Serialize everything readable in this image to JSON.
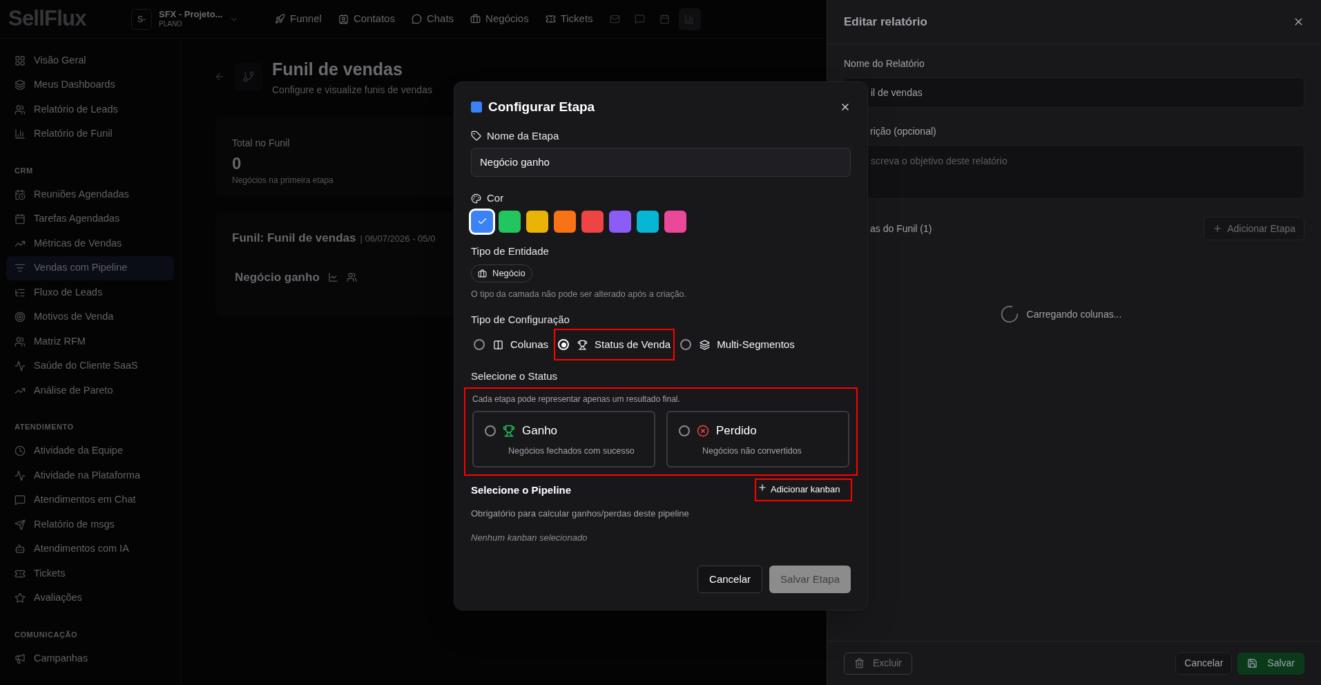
{
  "topbar": {
    "logo": "SellFlux",
    "workspace": {
      "initial": "S-",
      "name": "SFX - Projeto...",
      "plan": "PLANO"
    },
    "nav": [
      {
        "label": "Funnel"
      },
      {
        "label": "Contatos"
      },
      {
        "label": "Chats"
      },
      {
        "label": "Negócios"
      },
      {
        "label": "Tickets"
      }
    ],
    "icon_buttons": [
      {
        "selected": false
      },
      {
        "selected": false
      },
      {
        "selected": false
      },
      {
        "selected": true
      }
    ]
  },
  "sidebar": {
    "sections": [
      {
        "items": [
          {
            "label": "Visão Geral",
            "selected": false
          },
          {
            "label": "Meus Dashboards",
            "selected": false
          },
          {
            "label": "Relatório de Leads",
            "selected": false
          },
          {
            "label": "Relatório de Funil",
            "selected": false
          }
        ]
      },
      {
        "title": "CRM",
        "items": [
          {
            "label": "Reuniões Agendadas",
            "selected": false
          },
          {
            "label": "Tarefas Agendadas",
            "selected": false
          },
          {
            "label": "Métricas de Vendas",
            "selected": false
          },
          {
            "label": "Vendas com Pipeline",
            "selected": true
          },
          {
            "label": "Fluxo de Leads",
            "selected": false
          },
          {
            "label": "Motivos de Venda",
            "selected": false
          },
          {
            "label": "Matriz RFM",
            "selected": false
          },
          {
            "label": "Saúde do Cliente SaaS",
            "selected": false
          },
          {
            "label": "Análise de Pareto",
            "selected": false
          }
        ]
      },
      {
        "title": "ATENDIMENTO",
        "items": [
          {
            "label": "Atividade da Equipe",
            "selected": false
          },
          {
            "label": "Atividade na Plataforma",
            "selected": false
          },
          {
            "label": "Atendimentos em Chat",
            "selected": false
          },
          {
            "label": "Relatório de msgs",
            "selected": false
          },
          {
            "label": "Atendimentos com IA",
            "selected": false
          },
          {
            "label": "Tickets",
            "selected": false
          },
          {
            "label": "Avaliações",
            "selected": false
          }
        ]
      },
      {
        "title": "COMUNICAÇÃO",
        "items": [
          {
            "label": "Campanhas",
            "selected": false
          }
        ]
      }
    ]
  },
  "main": {
    "title": "Funil de vendas",
    "subtitle": "Configure e visualize funis de vendas",
    "total": {
      "label": "Total no Funil",
      "value": "0",
      "caption": "Negócios na primeira etapa"
    },
    "funnel": {
      "title": "Funil: Funil de vendas",
      "range": "| 06/07/2026 - 05/0",
      "stage": "Negócio ganho"
    }
  },
  "modal": {
    "title": "Configurar Etapa",
    "name_label": "Nome da Etapa",
    "name_value": "Negócio ganho",
    "color_label": "Cor",
    "colors": [
      {
        "color": "#3b82f6",
        "selected": true
      },
      {
        "color": "#22c55e",
        "selected": false
      },
      {
        "color": "#eab308",
        "selected": false
      },
      {
        "color": "#f97316",
        "selected": false
      },
      {
        "color": "#ef4444",
        "selected": false
      },
      {
        "color": "#8b5cf6",
        "selected": false
      },
      {
        "color": "#06b6d4",
        "selected": false
      },
      {
        "color": "#ec4899",
        "selected": false
      }
    ],
    "entity_label": "Tipo de Entidade",
    "entity": "Negócio",
    "entity_note": "O tipo da camada não pode ser alterado após a criação.",
    "config_label": "Tipo de Configuração",
    "config_options": [
      {
        "kind": "columns",
        "label": "Colunas",
        "selected": false,
        "highlighted": false
      },
      {
        "kind": "status",
        "label": "Status de Venda",
        "selected": true,
        "highlighted": true
      },
      {
        "kind": "segments",
        "label": "Multi-Segmentos",
        "selected": false,
        "highlighted": false
      }
    ],
    "status_label": "Selecione o Status",
    "status": {
      "highlighted": true,
      "caption": "Cada etapa pode representar apenas um resultado final.",
      "options": [
        {
          "kind": "won",
          "title": "Ganho",
          "description": "Negócios fechados com sucesso",
          "selected": false
        },
        {
          "kind": "lost",
          "title": "Perdido",
          "description": "Negócios não convertidos",
          "selected": false
        }
      ]
    },
    "pipeline": {
      "title": "Selecione o Pipeline",
      "add_button": {
        "label": "Adicionar kanban",
        "highlighted": true
      },
      "note": "Obrigatório para calcular ganhos/perdas deste pipeline",
      "empty": "Nenhum kanban selecionado"
    },
    "cancel": "Cancelar",
    "save": {
      "label": "Salvar Etapa",
      "disabled": true
    }
  },
  "drawer": {
    "title": "Editar relatório",
    "name_label": "Nome do Relatório",
    "name_value": "il de vendas",
    "desc_label": "rição (opcional)",
    "desc_placeholder": "screva o objetivo deste relatório",
    "stages_label": "as do Funil (1)",
    "add_stage": "Adicionar Etapa",
    "loading": "Carregando colunas...",
    "delete": "Excluir",
    "cancel": "Cancelar",
    "save": "Salvar"
  }
}
